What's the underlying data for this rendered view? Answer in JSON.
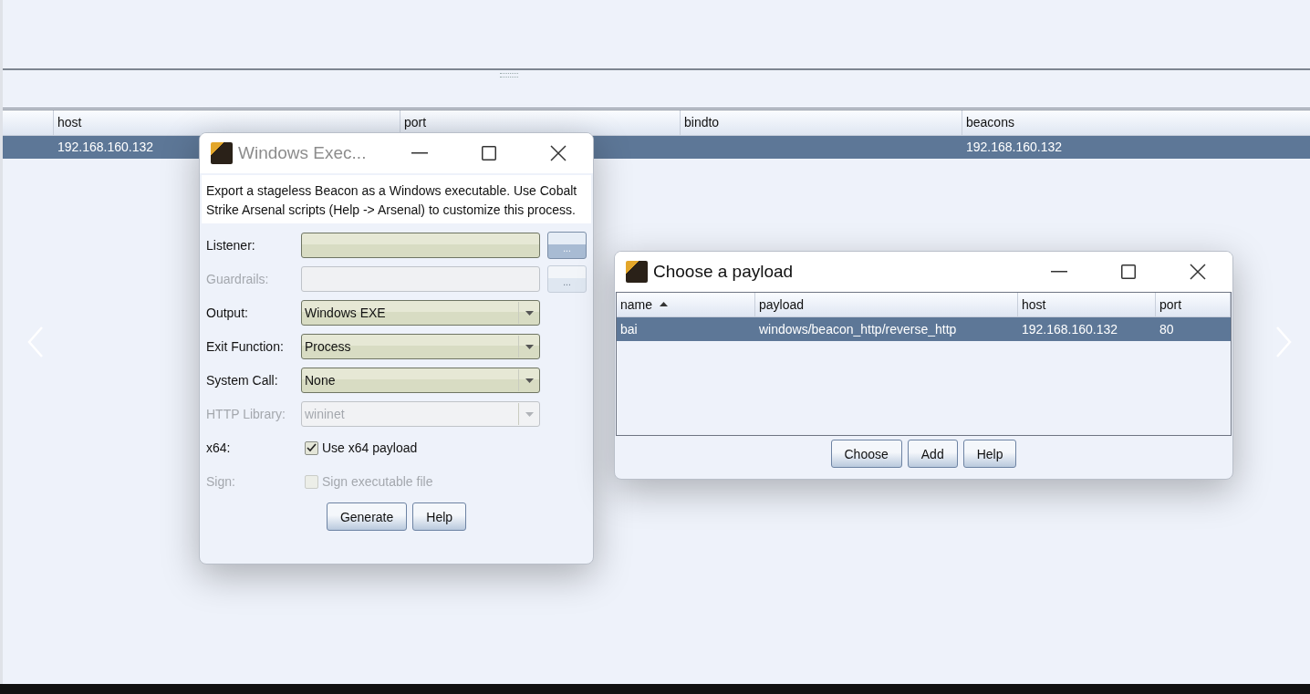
{
  "main_table": {
    "columns": [
      "host",
      "port",
      "bindto",
      "beacons"
    ],
    "rows": [
      {
        "selected": true,
        "host": "192.168.160.132",
        "beacons": "192.168.160.132"
      }
    ]
  },
  "export_dialog": {
    "title": "Windows Exec...",
    "active": false,
    "description": "Export a stageless Beacon as a Windows executable. Use Cobalt Strike Arsenal scripts (Help -> Arsenal) to customize this process.",
    "fields": [
      {
        "kind": "browse",
        "label": "Listener:",
        "disabled": false,
        "button_text": "..."
      },
      {
        "kind": "browse",
        "label": "Guardrails:",
        "disabled": true,
        "button_text": "..."
      },
      {
        "kind": "select",
        "label": "Output:",
        "value": "Windows EXE",
        "disabled": false
      },
      {
        "kind": "select",
        "label": "Exit Function:",
        "value": "Process",
        "disabled": false
      },
      {
        "kind": "select",
        "label": "System Call:",
        "value": "None",
        "disabled": false
      },
      {
        "kind": "select",
        "label": "HTTP Library:",
        "value": "wininet",
        "disabled": true
      },
      {
        "kind": "checkbox",
        "label": "x64:",
        "text": "Use x64 payload",
        "checked": true,
        "disabled": false
      },
      {
        "kind": "checkbox",
        "label": "Sign:",
        "text": "Sign executable file",
        "checked": false,
        "disabled": true
      }
    ],
    "buttons": [
      "Generate",
      "Help"
    ]
  },
  "payload_dialog": {
    "title": "Choose a payload",
    "active": true,
    "columns": [
      {
        "label": "name",
        "sorted": true
      },
      {
        "label": "payload",
        "sorted": false
      },
      {
        "label": "host",
        "sorted": false
      },
      {
        "label": "port",
        "sorted": false
      }
    ],
    "rows": [
      {
        "selected": true,
        "cells": [
          "bai",
          "windows/beacon_http/reverse_http",
          "192.168.160.132",
          "80"
        ]
      }
    ],
    "buttons": [
      "Choose",
      "Add",
      "Help"
    ]
  }
}
